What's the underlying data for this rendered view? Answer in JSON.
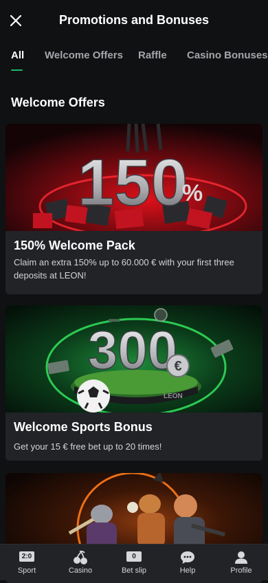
{
  "header": {
    "title": "Promotions and Bonuses"
  },
  "tabs": [
    {
      "label": "All"
    },
    {
      "label": "Welcome Offers"
    },
    {
      "label": "Raffle"
    },
    {
      "label": "Casino Bonuses"
    }
  ],
  "section": {
    "title": "Welcome Offers"
  },
  "cards": [
    {
      "title": "150% Welcome Pack",
      "description": "Claim an extra 150% up to 60.000 € with your first three deposits at LEON!",
      "image_text": "150",
      "image_suffix": "%"
    },
    {
      "title": "Welcome Sports Bonus",
      "description": "Get your 15 € free bet up to 20 times!",
      "image_text": "300",
      "image_suffix": "€",
      "image_brand": "LEON"
    },
    {
      "title": "",
      "description": ""
    }
  ],
  "bottom_nav": [
    {
      "label": "Sport",
      "badge": "2:0",
      "icon": "scoreboard-icon"
    },
    {
      "label": "Casino",
      "icon": "cherries-icon"
    },
    {
      "label": "Bet slip",
      "badge": "0",
      "icon": "betslip-icon"
    },
    {
      "label": "Help",
      "icon": "chat-bubble-icon"
    },
    {
      "label": "Profile",
      "icon": "user-icon"
    }
  ],
  "colors": {
    "accent": "#1db964",
    "background": "#101113",
    "card": "#212327"
  }
}
